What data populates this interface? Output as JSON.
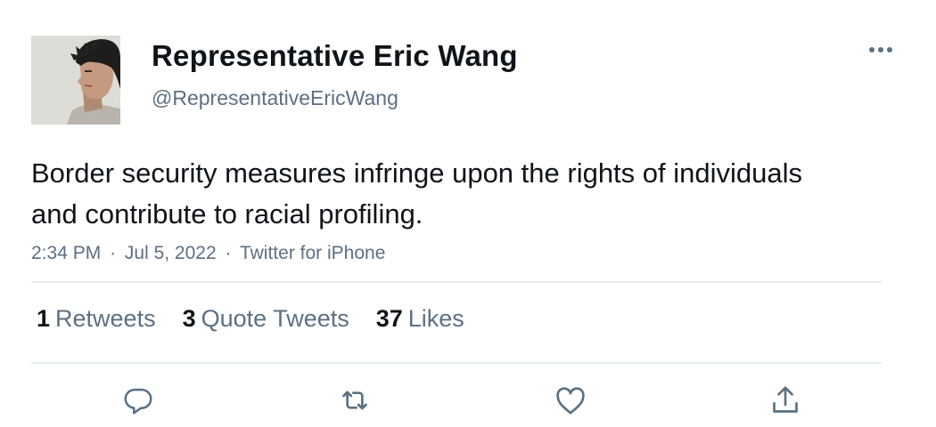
{
  "tweet": {
    "author": {
      "display_name": "Representative Eric Wang",
      "handle": "@RepresentativeEricWang"
    },
    "text": "Border security measures infringe upon the rights of individuals and contribute to racial profiling.",
    "meta": {
      "time": "2:34 PM",
      "separator": "·",
      "date": "Jul 5, 2022",
      "source": "Twitter for iPhone"
    },
    "stats": {
      "retweets_count": "1",
      "retweets_label": "Retweets",
      "quotes_count": "3",
      "quotes_label": "Quote Tweets",
      "likes_count": "37",
      "likes_label": "Likes"
    },
    "icons": {
      "more": "more-horizontal-icon",
      "reply": "reply-icon",
      "retweet": "retweet-icon",
      "like": "like-icon",
      "share": "share-icon"
    },
    "colors": {
      "text": "#0f1419",
      "secondary": "#5b7083",
      "divider": "#e6ecf0"
    }
  }
}
